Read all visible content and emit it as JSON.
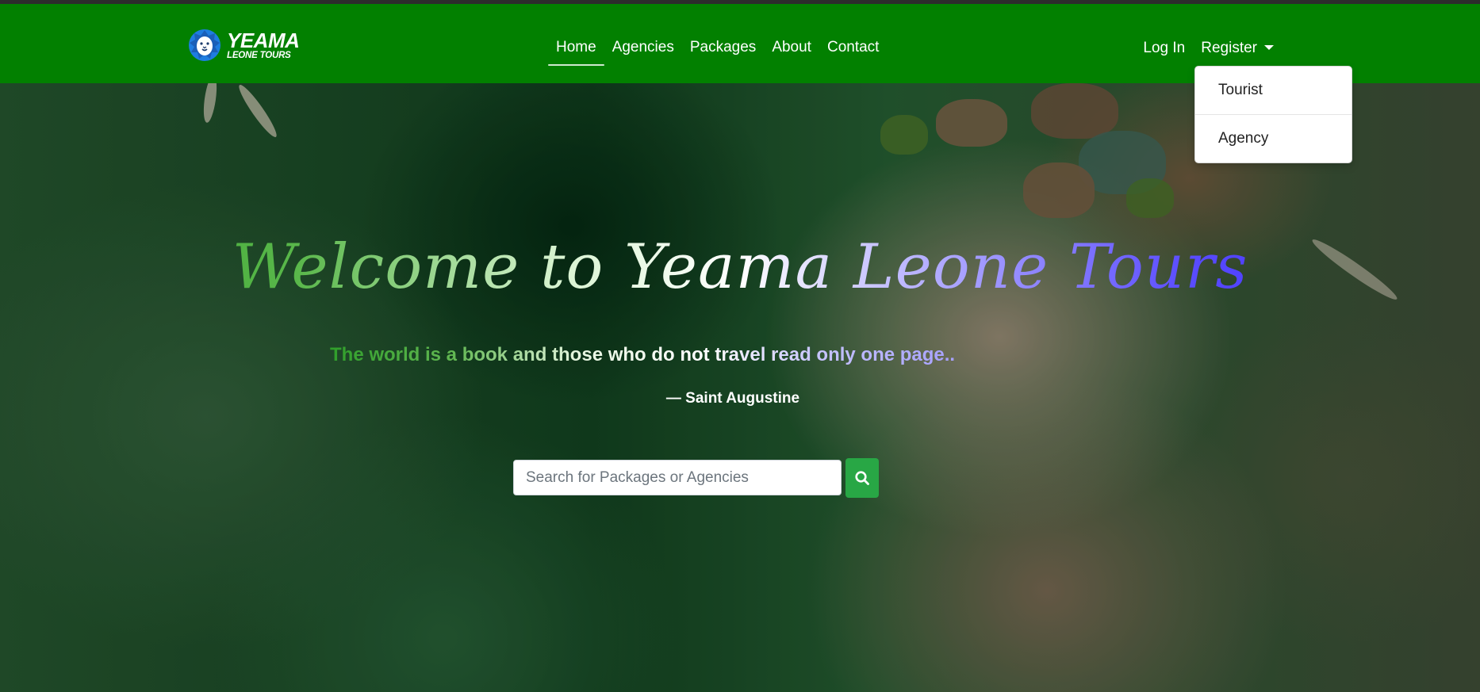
{
  "brand": {
    "line1": "YEAMA",
    "line2": "LEONE TOURS",
    "logo_icon": "lion-head-logo"
  },
  "nav": {
    "items": [
      {
        "label": "Home",
        "active": true
      },
      {
        "label": "Agencies",
        "active": false
      },
      {
        "label": "Packages",
        "active": false
      },
      {
        "label": "About",
        "active": false
      },
      {
        "label": "Contact",
        "active": false
      }
    ],
    "login_label": "Log In",
    "register_label": "Register"
  },
  "register_menu": {
    "items": [
      "Tourist",
      "Agency"
    ]
  },
  "hero": {
    "title": "Welcome to Yeama Leone Tours",
    "tagline": "The world is a book and those who do not travel read only one page..",
    "author": "— Saint Augustine"
  },
  "search": {
    "placeholder": "Search for Packages or Agencies",
    "value": "",
    "button_icon": "search-icon"
  },
  "colors": {
    "navbar": "#028000",
    "search_button": "#28a745",
    "dropdown_bg": "#ffffff"
  }
}
